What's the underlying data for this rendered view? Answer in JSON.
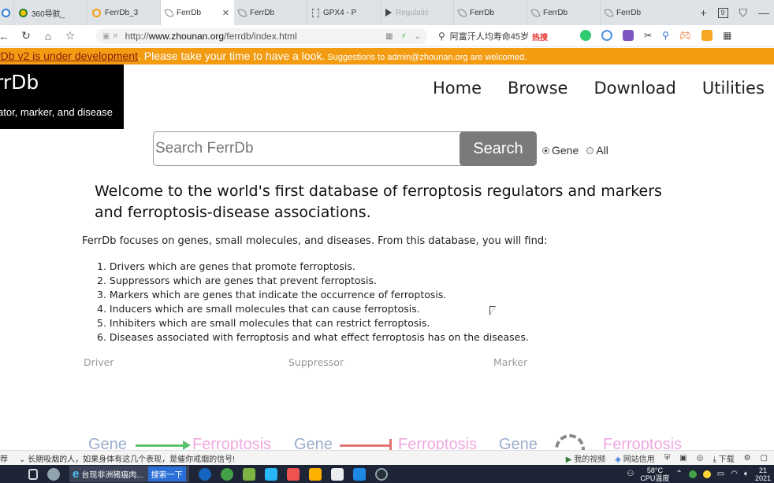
{
  "browser": {
    "tabs": [
      {
        "title": "",
        "icon": "browser-logo-icon"
      },
      {
        "title": "360导航_",
        "icon": "360-icon"
      },
      {
        "title": "FerrDb_3",
        "icon": "globe-icon"
      },
      {
        "title": "FerrDb",
        "icon": "leaf-icon",
        "active": true
      },
      {
        "title": "FerrDb",
        "icon": "leaf-icon"
      },
      {
        "title": "GPX4 - P",
        "icon": "doc-icon"
      },
      {
        "title": "Regulatic",
        "icon": "play-icon"
      },
      {
        "title": "FerrDb",
        "icon": "leaf-icon"
      },
      {
        "title": "FerrDb",
        "icon": "leaf-icon"
      },
      {
        "title": "FerrDb",
        "icon": "leaf-icon"
      }
    ],
    "tab_count": "9",
    "url_prefix": "http://",
    "url_domain": "www.zhounan.org",
    "url_path": "/ferrdb/index.html",
    "search_text": "阿富汗人均寿命45岁",
    "search_hot": "热搜"
  },
  "banner": {
    "link_text": "rDb v2 is under development",
    "comma": ".",
    "message": " Please take your time to have a look.",
    "suggestion": " Suggestions to admin@zhounan.org are welcomed."
  },
  "logo": {
    "name": "rrDb",
    "tagline": "ator, marker, and disease"
  },
  "nav": {
    "items": [
      "Home",
      "Browse",
      "Download",
      "Utilities"
    ]
  },
  "search": {
    "placeholder": "Search FerrDb",
    "button": "Search",
    "options": [
      {
        "label": "Gene",
        "selected": true
      },
      {
        "label": "All",
        "selected": false
      }
    ]
  },
  "welcome": "Welcome to the world's first database of ferroptosis regulators and markers and ferroptosis-disease associations.",
  "intro": "FerrDb focuses on genes, small molecules, and diseases. From this database, you will find:",
  "features": [
    "1. Drivers which are genes that promote ferroptosis.",
    "2. Suppressors which are genes that prevent ferroptosis.",
    "3. Markers which are genes that indicate the occurrence of ferroptosis.",
    "4. Inducers which are small molecules that can cause ferroptosis.",
    "5. Inhibiters which are small molecules that can restrict ferroptosis.",
    "6. Diseases associated with ferroptosis and what effect ferroptosis has on the diseases."
  ],
  "categories": [
    "Driver",
    "Suppressor",
    "Marker"
  ],
  "diagram": {
    "gene": "Gene",
    "ferroptosis": "Ferroptosis"
  },
  "statusbar": {
    "left": "荐",
    "news": "长期吸烟的人，如果身体有这几个表现，是催你戒烟的信号!",
    "video": "我的视频",
    "credit": "网站信用",
    "download": "下载"
  },
  "taskbar": {
    "browser_title": "台现非洲猪瘟肉...",
    "search_button": "搜索一下",
    "temperature": "58°C",
    "cpu_label": "CPU温度",
    "time": "21",
    "date": "2021"
  },
  "colors": {
    "banner": "#f39c12",
    "banner_link": "#8e1b0e",
    "search_button": "#7a7a7a",
    "gene_text": "#9aaecb",
    "ferroptosis_text": "#f0a8e0",
    "promote_arrow": "#5cc06a",
    "inhibit_arrow": "#e57373"
  }
}
